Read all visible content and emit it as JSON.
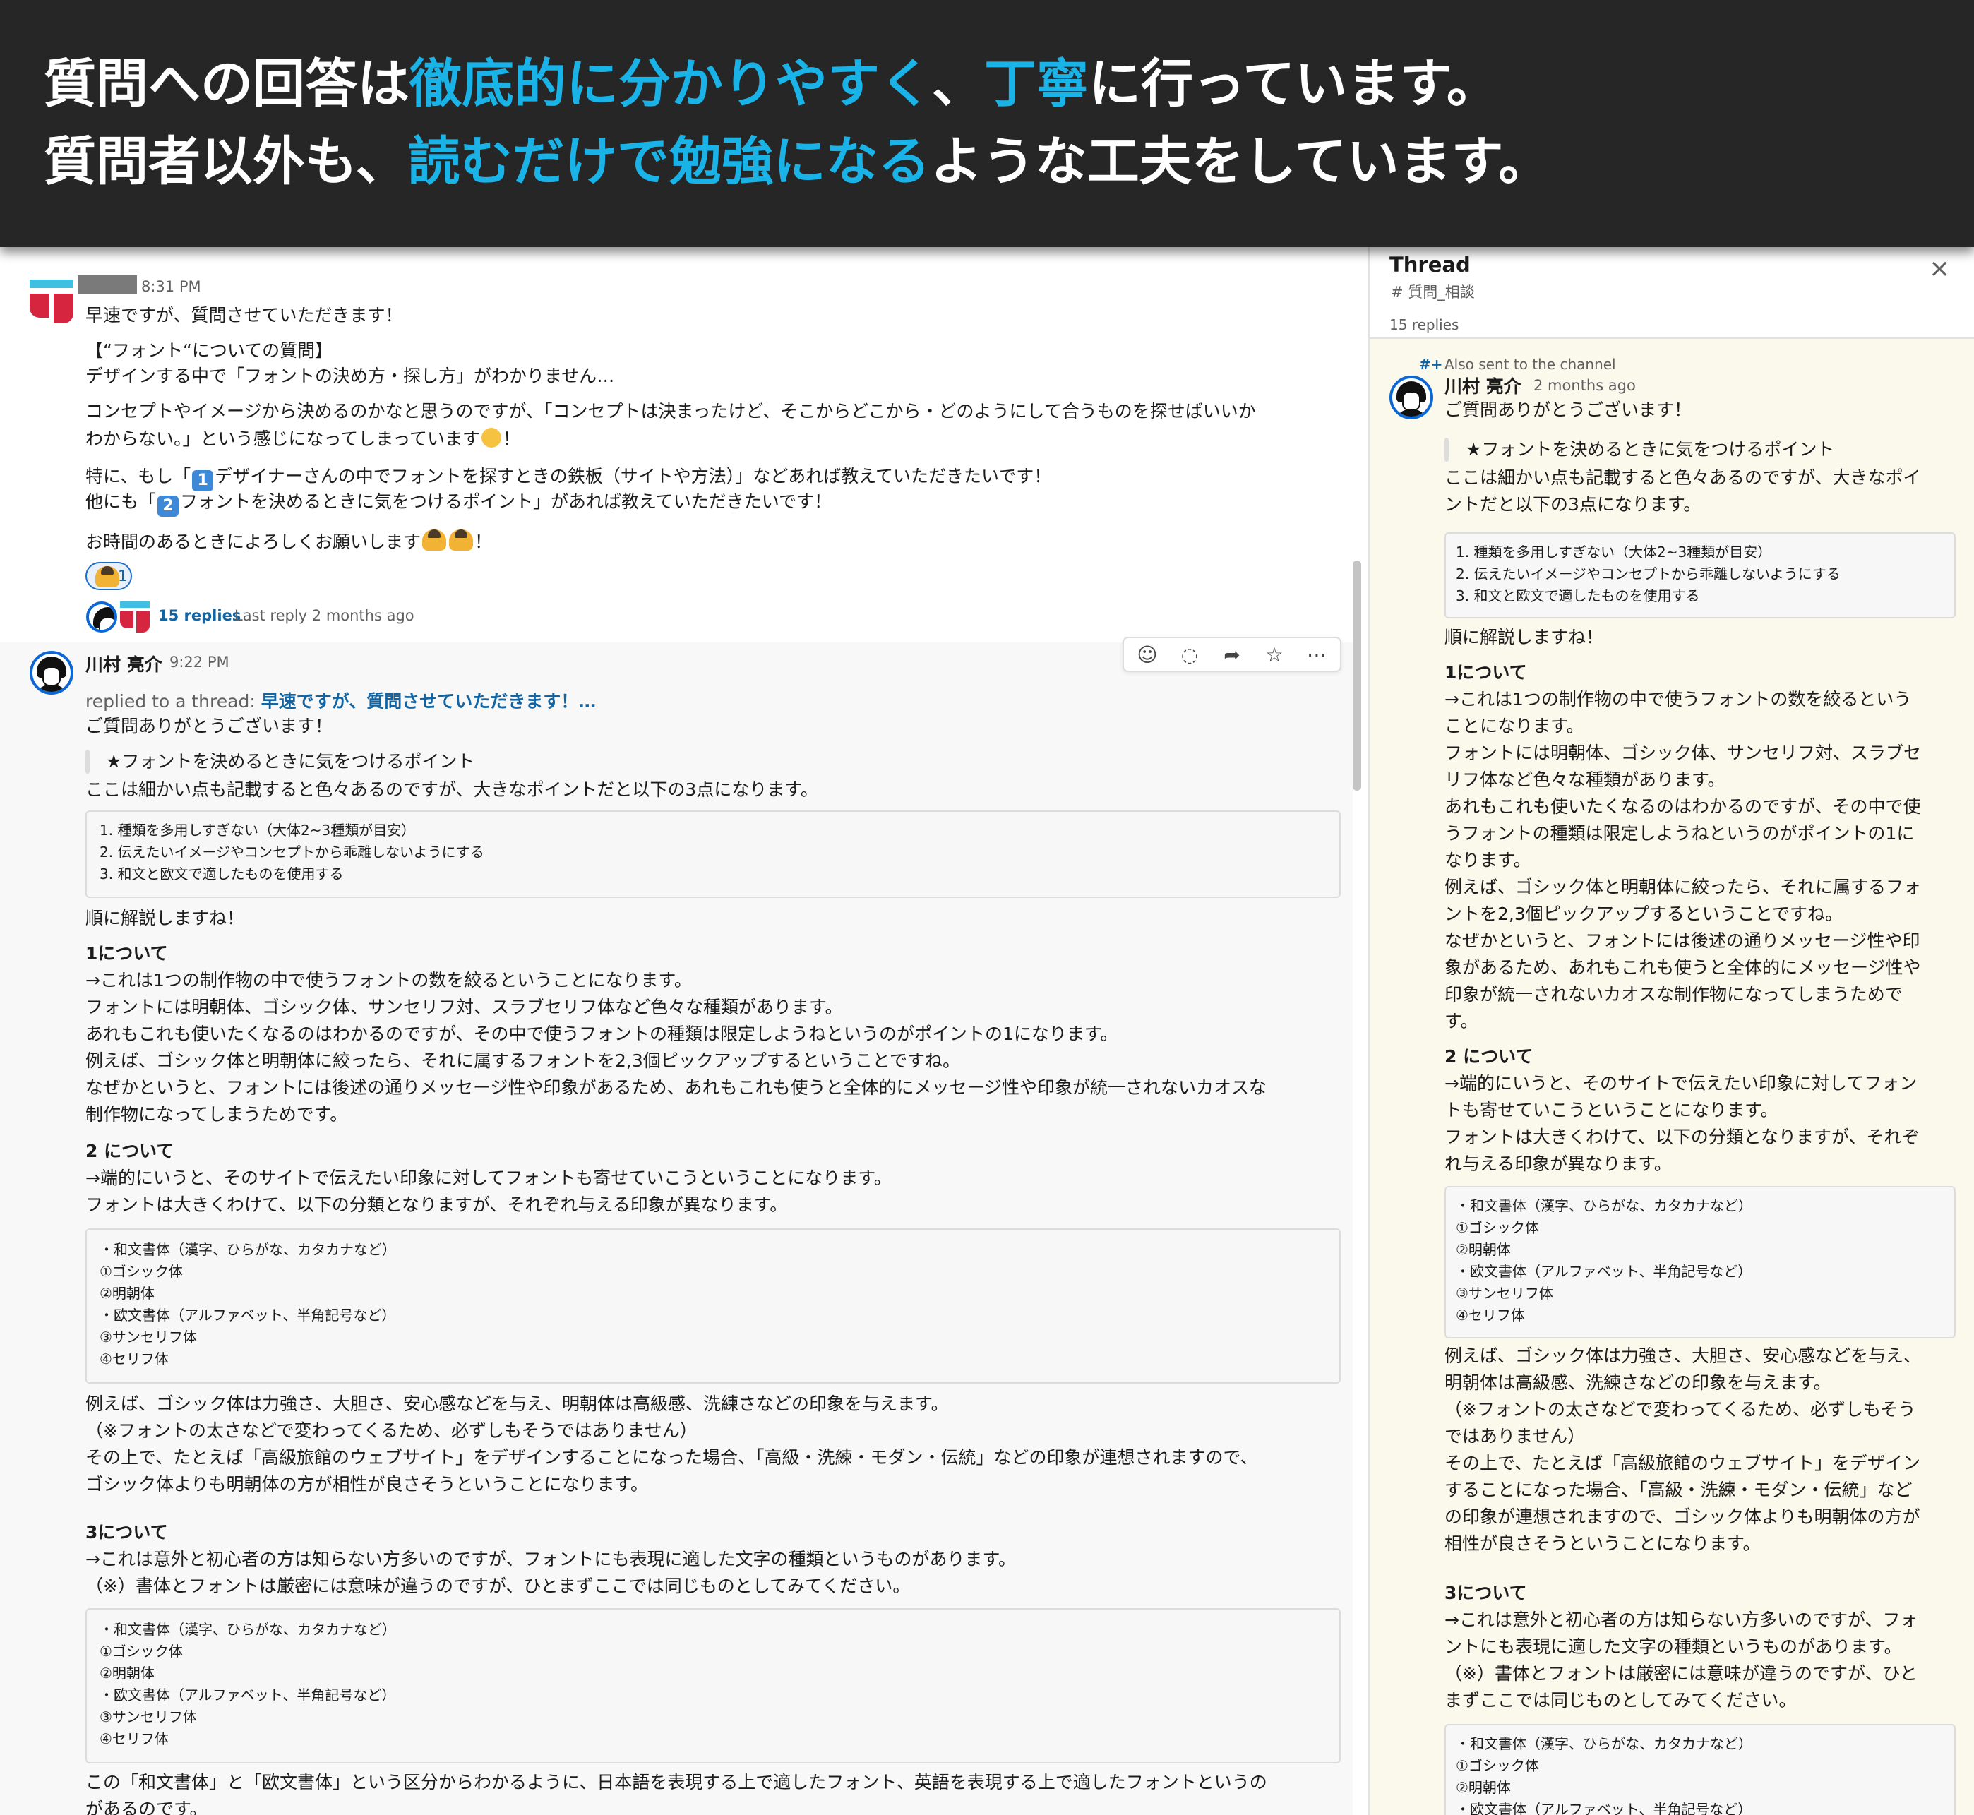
{
  "banner": {
    "line1_a": "質問への回答は",
    "line1_b": "徹底的に分かりやすく",
    "line1_c": "、",
    "line1_d": "丁寧",
    "line1_e": "に行っています。",
    "line2_a": "質問者以外も、",
    "line2_b": "読むだけで勉強になる",
    "line2_c": "ような工夫をしています。",
    "accent_color": "#1ab3e8",
    "background_color": "#262626"
  },
  "question": {
    "timestamp": "8:31 PM",
    "lines": [
      "早速ですが、質問させていただきます！",
      "【“フォント“についての質問】",
      "デザインする中で「フォントの決め方・探し方」がわかりません…",
      "コンセプトやイメージから決めるのかなと思うのですが、「コンセプトは決まったけど、そこからどこから・どのようにして合うものを探せばいいか",
      "わからない。」という感じになってしまっています",
      "！",
      "特に、もし「",
      "デザイナーさんの中でフォントを探すときの鉄板（サイトや方法）」などあれば教えていただきたいです！",
      "他にも「",
      "フォントを決めるときに気をつけるポイント」があれば教えていただきたいです！",
      "お時間のあるときによろしくお願いします",
      "！"
    ],
    "keycap_1": "1",
    "keycap_2": "2",
    "reaction_count": "1",
    "replies_link": "15 replies",
    "last_reply": "Last reply 2 months ago"
  },
  "reply": {
    "author": "川村 亮介",
    "timestamp": "9:22 PM",
    "replied_prefix": "replied to a thread: ",
    "replied_link": "早速ですが、質問させていただきます！…",
    "greeting": "ご質問ありがとうございます！",
    "quote": "★フォントを決めるときに気をつけるポイント",
    "intro": "ここは細かい点も記載すると色々あるのですが、大きなポイントだと以下の3点になります。",
    "points": [
      "1. 種類を多用しすぎない（大体2~3種類が目安）",
      "2. 伝えたいイメージやコンセプトから乖離しないようにする",
      "3. 和文と欧文で適したものを使用する"
    ],
    "explain": "順に解説しますね！",
    "sec1_title": "1について",
    "sec1_lines": [
      "→これは1つの制作物の中で使うフォントの数を絞るということになります。",
      "フォントには明朝体、ゴシック体、サンセリフ対、スラブセリフ体など色々な種類があります。",
      "あれもこれも使いたくなるのはわかるのですが、その中で使うフォントの種類は限定しようねというのがポイントの1になります。",
      "例えば、ゴシック体と明朝体に絞ったら、それに属するフォントを2,3個ピックアップするということですね。",
      "なぜかというと、フォントには後述の通りメッセージ性や印象があるため、あれもこれも使うと全体的にメッセージ性や印象が統一されないカオスな",
      "制作物になってしまうためです。"
    ],
    "sec2_title": "2 について",
    "sec2_lines": [
      "→端的にいうと、そのサイトで伝えたい印象に対してフォントも寄せていこうということになります。",
      "フォントは大きくわけて、以下の分類となりますが、それぞれ与える印象が異なります。"
    ],
    "types": [
      "・和文書体（漢字、ひらがな、カタカナなど）",
      "①ゴシック体",
      "②明朝体",
      "・欧文書体（アルファベット、半角記号など）",
      "③サンセリフ体",
      "④セリフ体"
    ],
    "sec2b_lines": [
      "例えば、ゴシック体は力強さ、大胆さ、安心感などを与え、明朝体は高級感、洗練さなどの印象を与えます。",
      "（※フォントの太さなどで変わってくるため、必ずしもそうではありません）",
      "その上で、たとえば「高級旅館のウェブサイト」をデザインすることになった場合、「高級・洗練・モダン・伝統」などの印象が連想されますので、",
      "ゴシック体よりも明朝体の方が相性が良さそうということになります。"
    ],
    "sec3_title": "3について",
    "sec3_lines": [
      "→これは意外と初心者の方は知らない方多いのですが、フォントにも表現に適した文字の種類というものがあります。",
      "（※）書体とフォントは厳密には意味が違うのですが、ひとまずここでは同じものとしてみてください。"
    ],
    "closing_lines": [
      "この「和文書体」と「欧文書体」という区分からわかるように、日本語を表現する上で適したフォント、英語を表現する上で適したフォントというの",
      "があるのです。"
    ]
  },
  "thread": {
    "title": "Thread",
    "channel": "# 質問_相談",
    "close": "×",
    "count": "15 replies",
    "also_sent_icon": "#+",
    "also_sent": "Also sent to the channel",
    "author": "川村 亮介",
    "timestamp": "2 months ago",
    "greeting": "ご質問ありがとうございます！",
    "quote": "★フォントを決めるときに気をつけるポイント",
    "intro_lines": [
      "ここは細かい点も記載すると色々あるのですが、大きなポイ",
      "ントだと以下の3点になります。"
    ],
    "points": [
      "1. 種類を多用しすぎない（大体2~3種類が目安）",
      "2. 伝えたいイメージやコンセプトから乖離しないようにする",
      "3. 和文と欧文で適したものを使用する"
    ],
    "explain": "順に解説しますね！",
    "sec1_title": "1について",
    "sec1_lines": [
      "→これは1つの制作物の中で使うフォントの数を絞るという",
      "ことになります。",
      "フォントには明朝体、ゴシック体、サンセリフ対、スラブセ",
      "リフ体など色々な種類があります。",
      "あれもこれも使いたくなるのはわかるのですが、その中で使",
      "うフォントの種類は限定しようねというのがポイントの1に",
      "なります。",
      "例えば、ゴシック体と明朝体に絞ったら、それに属するフォ",
      "ントを2,3個ピックアップするということですね。",
      "なぜかというと、フォントには後述の通りメッセージ性や印",
      "象があるため、あれもこれも使うと全体的にメッセージ性や",
      "印象が統一されないカオスな制作物になってしまうためで",
      "す。"
    ],
    "sec2_title": "2 について",
    "sec2_lines": [
      "→端的にいうと、そのサイトで伝えたい印象に対してフォン",
      "トも寄せていこうということになります。",
      "フォントは大きくわけて、以下の分類となりますが、それぞ",
      "れ与える印象が異なります。"
    ],
    "types": [
      "・和文書体（漢字、ひらがな、カタカナなど）",
      "①ゴシック体",
      "②明朝体",
      "・欧文書体（アルファベット、半角記号など）",
      "③サンセリフ体",
      "④セリフ体"
    ],
    "sec2b_lines": [
      "例えば、ゴシック体は力強さ、大胆さ、安心感などを与え、",
      "明朝体は高級感、洗練さなどの印象を与えます。",
      "（※フォントの太さなどで変わってくるため、必ずしもそう",
      "ではありません）",
      "その上で、たとえば「高級旅館のウェブサイト」をデザイン",
      "することになった場合、「高級・洗練・モダン・伝統」など",
      "の印象が連想されますので、ゴシック体よりも明朝体の方が",
      "相性が良さそうということになります。"
    ],
    "sec3_title": "3について",
    "sec3_lines": [
      "→これは意外と初心者の方は知らない方多いのですが、フォ",
      "ントにも表現に適した文字の種類というものがあります。",
      "（※）書体とフォントは厳密には意味が違うのですが、ひと",
      "まずここでは同じものとしてみてください。"
    ],
    "types2": [
      "・和文書体（漢字、ひらがな、カタカナなど）",
      "①ゴシック体",
      "②明朝体",
      "・欧文書体（アルファベット、半角記号など）"
    ]
  },
  "toolbar": {
    "icons": [
      "add-reaction-icon",
      "reply-in-thread-icon",
      "forward-icon",
      "bookmark-icon",
      "more-actions-icon"
    ],
    "glyphs": [
      "☺",
      "◌",
      "➦",
      "☆",
      "⋯"
    ]
  }
}
